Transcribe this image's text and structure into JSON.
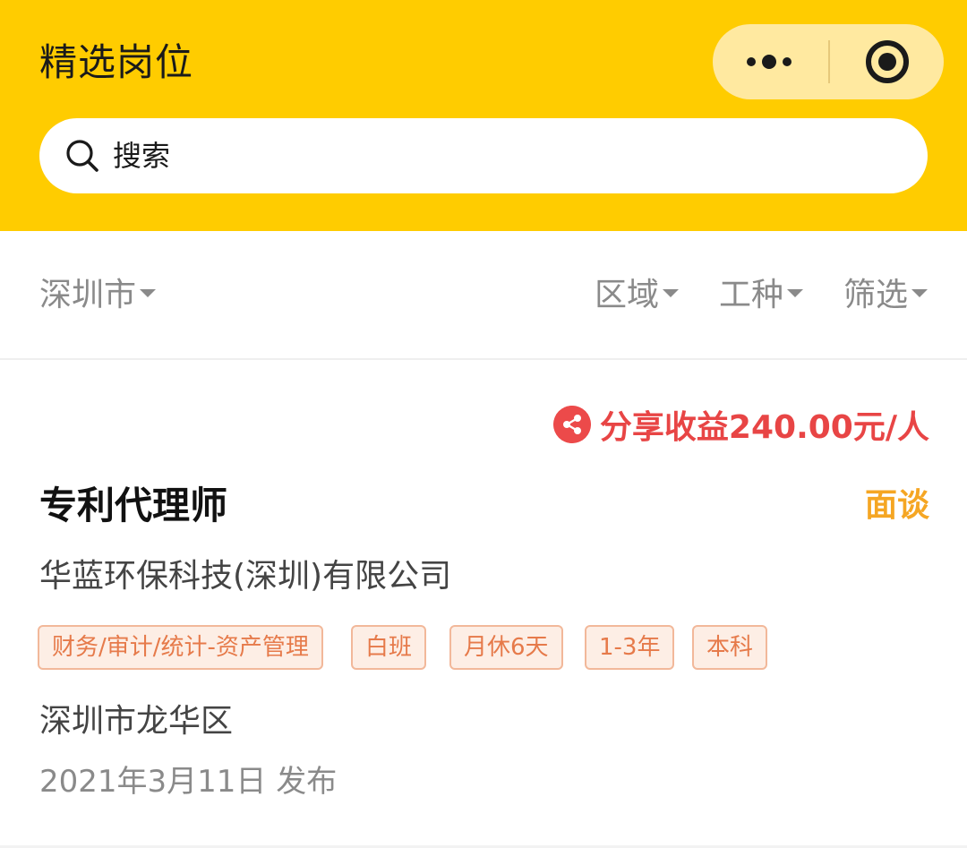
{
  "header": {
    "title": "精选岗位",
    "search_placeholder": "搜索",
    "more_icon": "more-dots-icon",
    "close_icon": "target-close-icon",
    "background_color": "#FFCC00"
  },
  "filters": {
    "city": "深圳市",
    "region": "区域",
    "job_type": "工种",
    "screen": "筛选"
  },
  "job": {
    "share_reward": "分享收益240.00元/人",
    "title": "专利代理师",
    "salary": "面谈",
    "company": "华蓝环保科技(深圳)有限公司",
    "tags": [
      "财务/审计/统计-资产管理",
      "白班",
      "月休6天",
      "1-3年",
      "本科"
    ],
    "location": "深圳市龙华区",
    "published": "2021年3月11日 发布",
    "accent_color": "#E84545",
    "salary_color": "#F5A623"
  }
}
